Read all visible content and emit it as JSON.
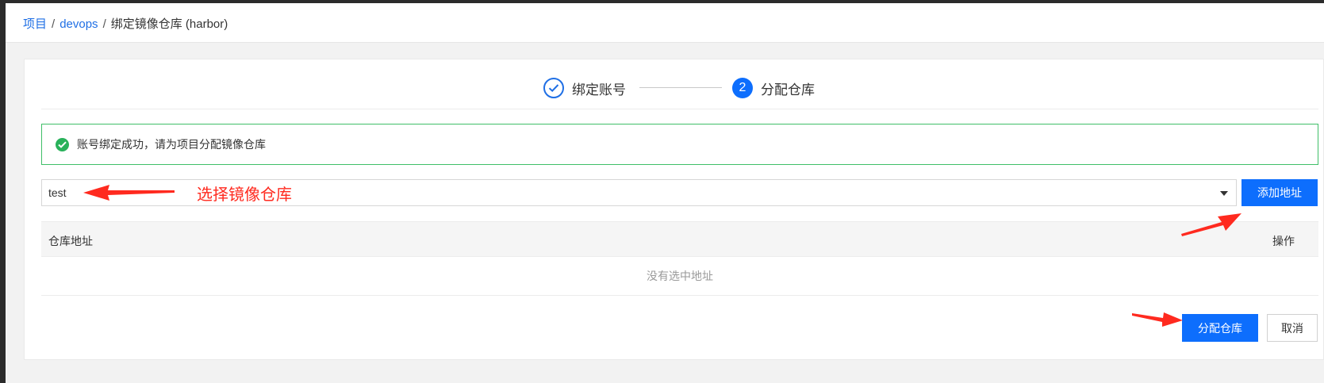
{
  "breadcrumb": {
    "project": "项目",
    "separator": "/",
    "devops": "devops",
    "current": "绑定镜像仓库 (harbor)"
  },
  "steps": [
    {
      "label": "绑定账号",
      "status": "done"
    },
    {
      "number": "2",
      "label": "分配仓库",
      "status": "active"
    }
  ],
  "alert": {
    "text": "账号绑定成功，请为项目分配镜像仓库",
    "icon": "check-circle-icon"
  },
  "repo_select": {
    "value": "test"
  },
  "add_button_label": "添加地址",
  "table": {
    "columns": [
      "仓库地址",
      "操作"
    ],
    "empty_text": "没有选中地址"
  },
  "footer": {
    "assign_label": "分配仓库",
    "cancel_label": "取消"
  },
  "annotation": {
    "text": "选择镜像仓库",
    "color": "#ff2a1f"
  },
  "colors": {
    "primary": "#0d6efd",
    "success": "#28b15a",
    "link": "#1f6fe5"
  }
}
